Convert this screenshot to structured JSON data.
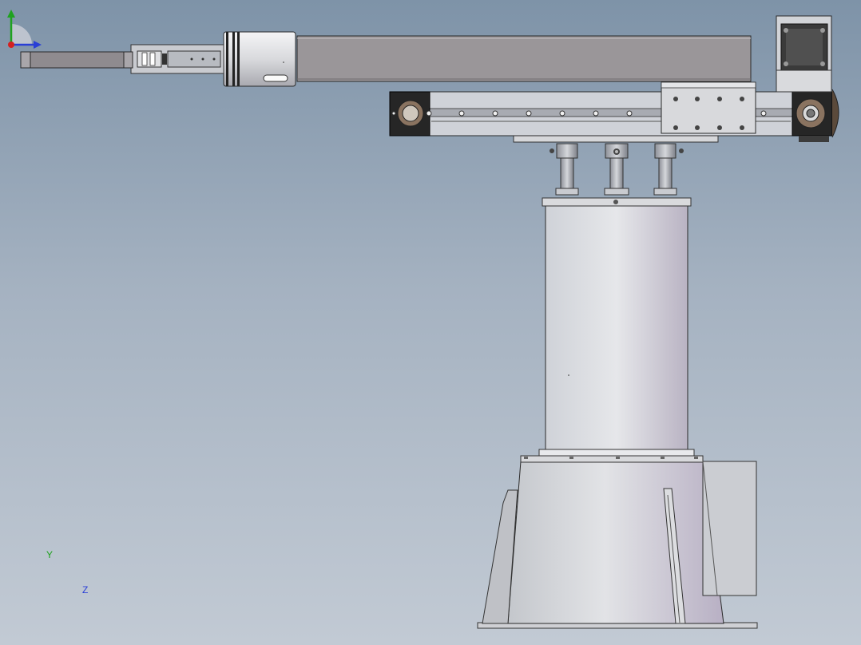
{
  "viewport": {
    "background_top": "#7e93a8",
    "background_bottom": "#c2cad4",
    "model": "robot-arm-assembly"
  },
  "triad": {
    "y_label": "Y",
    "z_label": "Z",
    "colors": {
      "y": "#1fa21f",
      "z": "#2a3fd6",
      "x": "#d42020"
    }
  }
}
